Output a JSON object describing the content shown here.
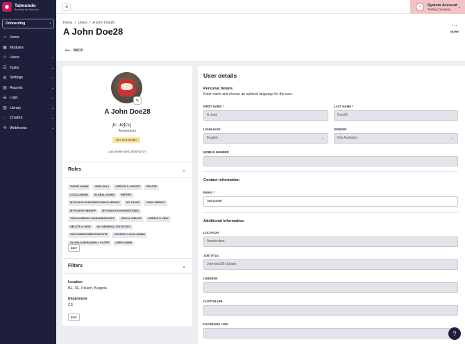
{
  "brand": {
    "name": "Talmundo",
    "subtitle": "Boarding by Talmundo",
    "logo_glyph": "✱"
  },
  "sidebar": {
    "onboarding_label": "Onboarding",
    "items": [
      {
        "label": "Home",
        "icon": "home-icon",
        "glyph": "⌂",
        "chevron": ""
      },
      {
        "label": "Modules",
        "icon": "modules-icon",
        "glyph": "▦",
        "chevron": ""
      },
      {
        "label": "Users",
        "icon": "users-icon",
        "glyph": "☺",
        "chevron": "⌄"
      },
      {
        "label": "Tasks",
        "icon": "tasks-icon",
        "glyph": "☑",
        "chevron": "⌄"
      },
      {
        "label": "Settings",
        "icon": "settings-icon",
        "glyph": "⚙",
        "chevron": "⌄"
      },
      {
        "label": "Reports",
        "icon": "reports-icon",
        "glyph": "▤",
        "chevron": "⌄"
      },
      {
        "label": "Logs",
        "icon": "logs-icon",
        "glyph": "☰",
        "chevron": "⌄"
      },
      {
        "label": "Library",
        "icon": "library-icon",
        "glyph": "▥",
        "chevron": "⌄"
      },
      {
        "label": "Chatbot",
        "icon": "chatbot-icon",
        "glyph": "◌",
        "chevron": "⌄"
      },
      {
        "label": "Webhooks",
        "icon": "webhooks-icon",
        "glyph": "⟲",
        "chevron": "⌄"
      }
    ]
  },
  "account": {
    "name": "System Account",
    "company": "Testing Company"
  },
  "breadcrumb": [
    "Home",
    "/",
    "Users",
    "/",
    "A John Doe28"
  ],
  "page_title": "A John Doe28",
  "more_label": "MORE",
  "back_label": "BACK",
  "profile": {
    "name": "A John Doe28",
    "signature": "p. ɹeʃcq",
    "location": "Amsterdam",
    "status": "NOT ACTIVATED",
    "invite_text": "Last invite sent 2026-03-27"
  },
  "roles": {
    "title": "Roles",
    "chips": [
      "SUPER ADMIN",
      "VIEW ONLY",
      "CREATE & UPDATE",
      "DELETE",
      "LOCALADMIN",
      "GLOBAL ADMIN",
      "REPORT",
      "MYTASKS+ASSIGNEDTASKS+LIBRARY",
      "MY TASKS",
      "TASK LIBRARY",
      "MYTASKS+LIBRARY",
      "MYTASKS+ASSIGNEDTASKS",
      "TASKSLIBRARY+ASSIGNEDTASKS",
      "VIEW & CREATE",
      "CREATE & VIEW",
      "DELETE & VIEW",
      "NO-GENERAL-STATISTICS",
      "ONLYUSERSCREATEUPDATE",
      "CONTENT LOCALADMIN",
      "GLOBALUSERADMIN + FILTER",
      "USER ADMIN"
    ],
    "edit_label": "EDIT"
  },
  "filters": {
    "title": "Filters",
    "location_label": "Location",
    "location_value": "BE, DE, Poland, Bulgaria",
    "department_label": "Department",
    "department_value": "CS",
    "edit_label": "EDIT"
  },
  "details": {
    "title": "User details",
    "personal_title": "Personal details",
    "personal_sub": "Enter name and choose an optional language for the user.",
    "first_name_label": "FIRST NAME *",
    "first_name": "A John",
    "last_name_label": "LAST NAME *",
    "last_name": "Doe28",
    "language_label": "LANGUAGE",
    "language": "English",
    "gender_label": "GENDER",
    "gender": "Not Available",
    "mobile_label": "MOBILE NUMBER",
    "mobile": "",
    "contact_title": "Contact information",
    "email_label": "EMAIL *",
    "email": "naoyuoan",
    "additional_title": "Additional information",
    "location_label": "LOCATION",
    "location": "Amsterdam",
    "job_title_label": "JOB TITLE",
    "job_title": "Johndoe28-Update",
    "linkedin_label": "LINKEDIN",
    "linkedin": "",
    "custom_url_label": "CUSTOM URL",
    "custom_url": "",
    "facebook_label": "FACEBOOK LINK",
    "facebook": ""
  },
  "colors": {
    "sidebar": "#1d1f3b",
    "account_bg": "#f4c3c8",
    "badge": "#f6e3a0",
    "brand": "#c2185b"
  }
}
